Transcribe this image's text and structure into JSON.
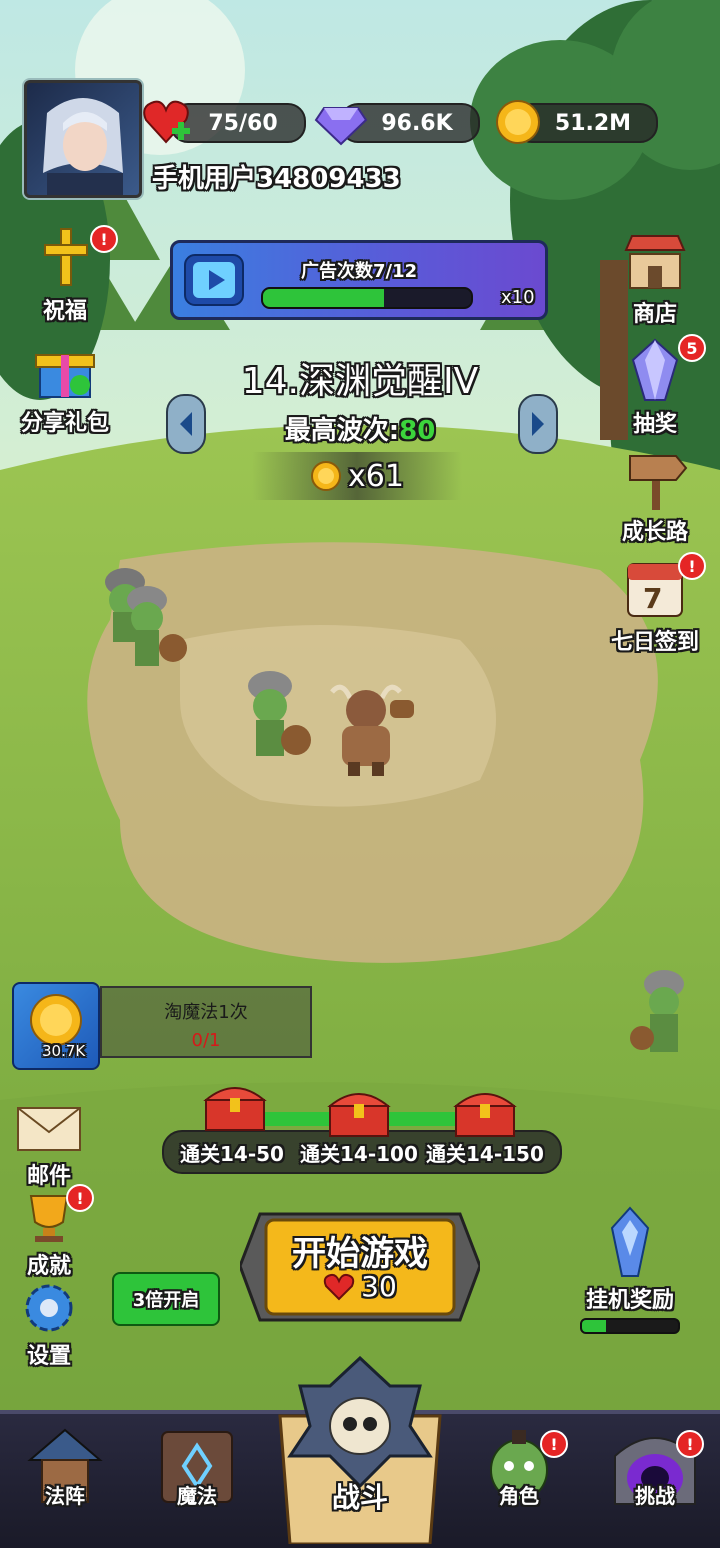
{
  "player": {
    "name": "手机用户34809433"
  },
  "resources": {
    "energy": "75/60",
    "gems": "96.6K",
    "coins": "51.2M"
  },
  "ad_banner": {
    "title": "广告次数7/12",
    "multiplier": "x10",
    "progress": 0.58
  },
  "level": {
    "name": "14.深渊觉醒IV",
    "best_wave_label": "最高波次:",
    "best_wave_value": "80",
    "reward": "x61"
  },
  "left_menu": {
    "bless": "祝福",
    "share_gift": "分享礼包",
    "mail": "邮件",
    "achievement": "成就",
    "settings": "设置"
  },
  "right_menu": {
    "shop": "商店",
    "draw": "抽奖",
    "draw_badge": "5",
    "growth": "成长路",
    "checkin": "七日签到",
    "checkin_day": "7"
  },
  "quest": {
    "title": "淘魔法1次",
    "progress": "0/1",
    "coin_amount": "30.7K"
  },
  "milestones": [
    "通关14-50",
    "通关14-100",
    "通关14-150"
  ],
  "start": {
    "label": "开始游戏",
    "cost": "30"
  },
  "speed_button": "3倍开启",
  "idle_reward": {
    "label": "挂机奖励",
    "progress": 0.25
  },
  "nav": {
    "formation": "法阵",
    "magic": "魔法",
    "battle": "战斗",
    "character": "角色",
    "challenge": "挑战"
  },
  "colors": {
    "accent_green": "#3cc43c",
    "gold": "#f2c21b",
    "badge_red": "#e52525"
  }
}
